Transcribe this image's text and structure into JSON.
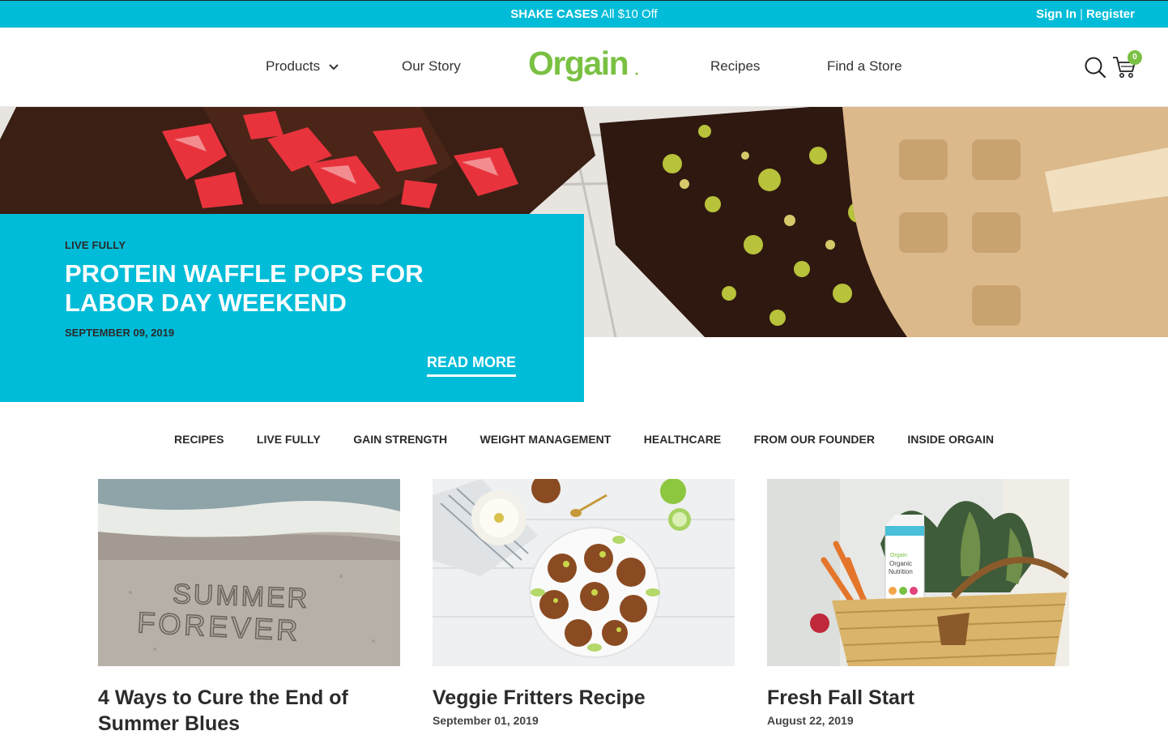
{
  "promo": {
    "bold": "SHAKE CASES",
    "text": " All $10 Off"
  },
  "auth": {
    "sign_in": "Sign In",
    "separator": "|",
    "register": "Register"
  },
  "nav": {
    "products": "Products",
    "our_story": "Our Story",
    "recipes": "Recipes",
    "find_store": "Find a Store",
    "logo_text": "Orgain",
    "cart_count": "0"
  },
  "hero": {
    "category": "LIVE FULLY",
    "title": "PROTEIN WAFFLE POPS FOR LABOR DAY WEEKEND",
    "date": "SEPTEMBER 09, 2019",
    "cta": "READ MORE"
  },
  "categories": [
    "RECIPES",
    "LIVE FULLY",
    "GAIN STRENGTH",
    "WEIGHT MANAGEMENT",
    "HEALTHCARE",
    "FROM OUR FOUNDER",
    "INSIDE ORGAIN"
  ],
  "articles": [
    {
      "title": "4 Ways to Cure the End of Summer Blues",
      "date": "",
      "image_text": "SUMMER FOREVER"
    },
    {
      "title": "Veggie Fritters Recipe",
      "date": "September 01, 2019"
    },
    {
      "title": "Fresh Fall Start",
      "date": "August 22, 2019",
      "image_text": "Orgain Organic Nutrition"
    }
  ],
  "colors": {
    "brand_blue": "#00bcd8",
    "brand_green": "#7ac143"
  }
}
